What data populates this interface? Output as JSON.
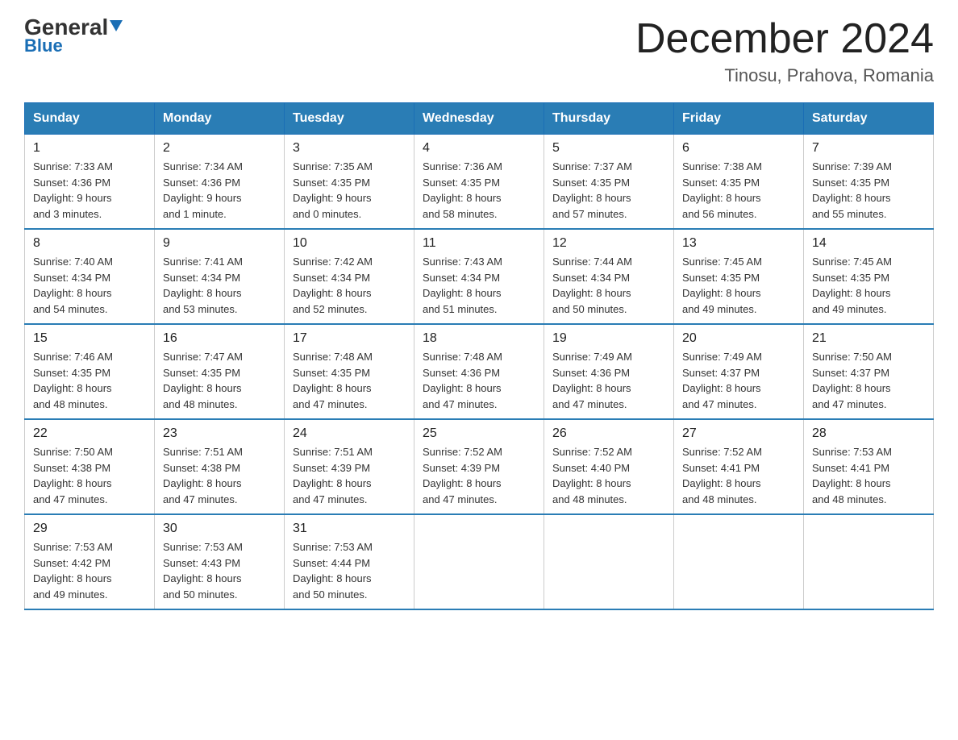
{
  "header": {
    "logo_general": "General",
    "logo_blue": "Blue",
    "month_title": "December 2024",
    "location": "Tinosu, Prahova, Romania"
  },
  "days_of_week": [
    "Sunday",
    "Monday",
    "Tuesday",
    "Wednesday",
    "Thursday",
    "Friday",
    "Saturday"
  ],
  "weeks": [
    [
      {
        "day": "1",
        "info": "Sunrise: 7:33 AM\nSunset: 4:36 PM\nDaylight: 9 hours\nand 3 minutes."
      },
      {
        "day": "2",
        "info": "Sunrise: 7:34 AM\nSunset: 4:36 PM\nDaylight: 9 hours\nand 1 minute."
      },
      {
        "day": "3",
        "info": "Sunrise: 7:35 AM\nSunset: 4:35 PM\nDaylight: 9 hours\nand 0 minutes."
      },
      {
        "day": "4",
        "info": "Sunrise: 7:36 AM\nSunset: 4:35 PM\nDaylight: 8 hours\nand 58 minutes."
      },
      {
        "day": "5",
        "info": "Sunrise: 7:37 AM\nSunset: 4:35 PM\nDaylight: 8 hours\nand 57 minutes."
      },
      {
        "day": "6",
        "info": "Sunrise: 7:38 AM\nSunset: 4:35 PM\nDaylight: 8 hours\nand 56 minutes."
      },
      {
        "day": "7",
        "info": "Sunrise: 7:39 AM\nSunset: 4:35 PM\nDaylight: 8 hours\nand 55 minutes."
      }
    ],
    [
      {
        "day": "8",
        "info": "Sunrise: 7:40 AM\nSunset: 4:34 PM\nDaylight: 8 hours\nand 54 minutes."
      },
      {
        "day": "9",
        "info": "Sunrise: 7:41 AM\nSunset: 4:34 PM\nDaylight: 8 hours\nand 53 minutes."
      },
      {
        "day": "10",
        "info": "Sunrise: 7:42 AM\nSunset: 4:34 PM\nDaylight: 8 hours\nand 52 minutes."
      },
      {
        "day": "11",
        "info": "Sunrise: 7:43 AM\nSunset: 4:34 PM\nDaylight: 8 hours\nand 51 minutes."
      },
      {
        "day": "12",
        "info": "Sunrise: 7:44 AM\nSunset: 4:34 PM\nDaylight: 8 hours\nand 50 minutes."
      },
      {
        "day": "13",
        "info": "Sunrise: 7:45 AM\nSunset: 4:35 PM\nDaylight: 8 hours\nand 49 minutes."
      },
      {
        "day": "14",
        "info": "Sunrise: 7:45 AM\nSunset: 4:35 PM\nDaylight: 8 hours\nand 49 minutes."
      }
    ],
    [
      {
        "day": "15",
        "info": "Sunrise: 7:46 AM\nSunset: 4:35 PM\nDaylight: 8 hours\nand 48 minutes."
      },
      {
        "day": "16",
        "info": "Sunrise: 7:47 AM\nSunset: 4:35 PM\nDaylight: 8 hours\nand 48 minutes."
      },
      {
        "day": "17",
        "info": "Sunrise: 7:48 AM\nSunset: 4:35 PM\nDaylight: 8 hours\nand 47 minutes."
      },
      {
        "day": "18",
        "info": "Sunrise: 7:48 AM\nSunset: 4:36 PM\nDaylight: 8 hours\nand 47 minutes."
      },
      {
        "day": "19",
        "info": "Sunrise: 7:49 AM\nSunset: 4:36 PM\nDaylight: 8 hours\nand 47 minutes."
      },
      {
        "day": "20",
        "info": "Sunrise: 7:49 AM\nSunset: 4:37 PM\nDaylight: 8 hours\nand 47 minutes."
      },
      {
        "day": "21",
        "info": "Sunrise: 7:50 AM\nSunset: 4:37 PM\nDaylight: 8 hours\nand 47 minutes."
      }
    ],
    [
      {
        "day": "22",
        "info": "Sunrise: 7:50 AM\nSunset: 4:38 PM\nDaylight: 8 hours\nand 47 minutes."
      },
      {
        "day": "23",
        "info": "Sunrise: 7:51 AM\nSunset: 4:38 PM\nDaylight: 8 hours\nand 47 minutes."
      },
      {
        "day": "24",
        "info": "Sunrise: 7:51 AM\nSunset: 4:39 PM\nDaylight: 8 hours\nand 47 minutes."
      },
      {
        "day": "25",
        "info": "Sunrise: 7:52 AM\nSunset: 4:39 PM\nDaylight: 8 hours\nand 47 minutes."
      },
      {
        "day": "26",
        "info": "Sunrise: 7:52 AM\nSunset: 4:40 PM\nDaylight: 8 hours\nand 48 minutes."
      },
      {
        "day": "27",
        "info": "Sunrise: 7:52 AM\nSunset: 4:41 PM\nDaylight: 8 hours\nand 48 minutes."
      },
      {
        "day": "28",
        "info": "Sunrise: 7:53 AM\nSunset: 4:41 PM\nDaylight: 8 hours\nand 48 minutes."
      }
    ],
    [
      {
        "day": "29",
        "info": "Sunrise: 7:53 AM\nSunset: 4:42 PM\nDaylight: 8 hours\nand 49 minutes."
      },
      {
        "day": "30",
        "info": "Sunrise: 7:53 AM\nSunset: 4:43 PM\nDaylight: 8 hours\nand 50 minutes."
      },
      {
        "day": "31",
        "info": "Sunrise: 7:53 AM\nSunset: 4:44 PM\nDaylight: 8 hours\nand 50 minutes."
      },
      {
        "day": "",
        "info": ""
      },
      {
        "day": "",
        "info": ""
      },
      {
        "day": "",
        "info": ""
      },
      {
        "day": "",
        "info": ""
      }
    ]
  ]
}
